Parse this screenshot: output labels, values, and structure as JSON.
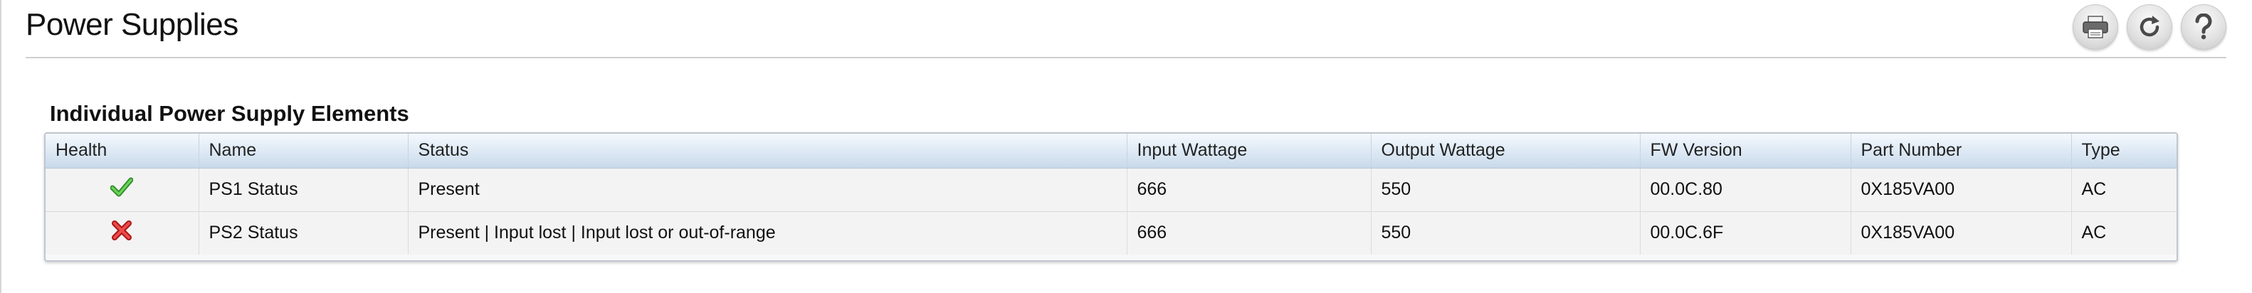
{
  "page": {
    "title": "Power Supplies"
  },
  "toolbar": {
    "buttons": [
      {
        "name": "print-icon"
      },
      {
        "name": "refresh-icon"
      },
      {
        "name": "help-icon"
      }
    ]
  },
  "section": {
    "title": "Individual Power Supply Elements"
  },
  "table": {
    "headers": [
      "Health",
      "Name",
      "Status",
      "Input Wattage",
      "Output Wattage",
      "FW Version",
      "Part Number",
      "Type"
    ],
    "rows": [
      {
        "health": "ok",
        "health_icon": "checkmark-icon",
        "health_color": "#3aa830",
        "name": "PS1 Status",
        "status": "Present",
        "input_wattage": "666",
        "output_wattage": "550",
        "fw_version": "00.0C.80",
        "part_number": "0X185VA00",
        "type": "AC"
      },
      {
        "health": "critical",
        "health_icon": "x-mark-icon",
        "health_color": "#d42b2b",
        "name": "PS2 Status",
        "status": "Present | Input lost | Input lost or out-of-range",
        "input_wattage": "666",
        "output_wattage": "550",
        "fw_version": "00.0C.6F",
        "part_number": "0X185VA00",
        "type": "AC"
      }
    ]
  }
}
